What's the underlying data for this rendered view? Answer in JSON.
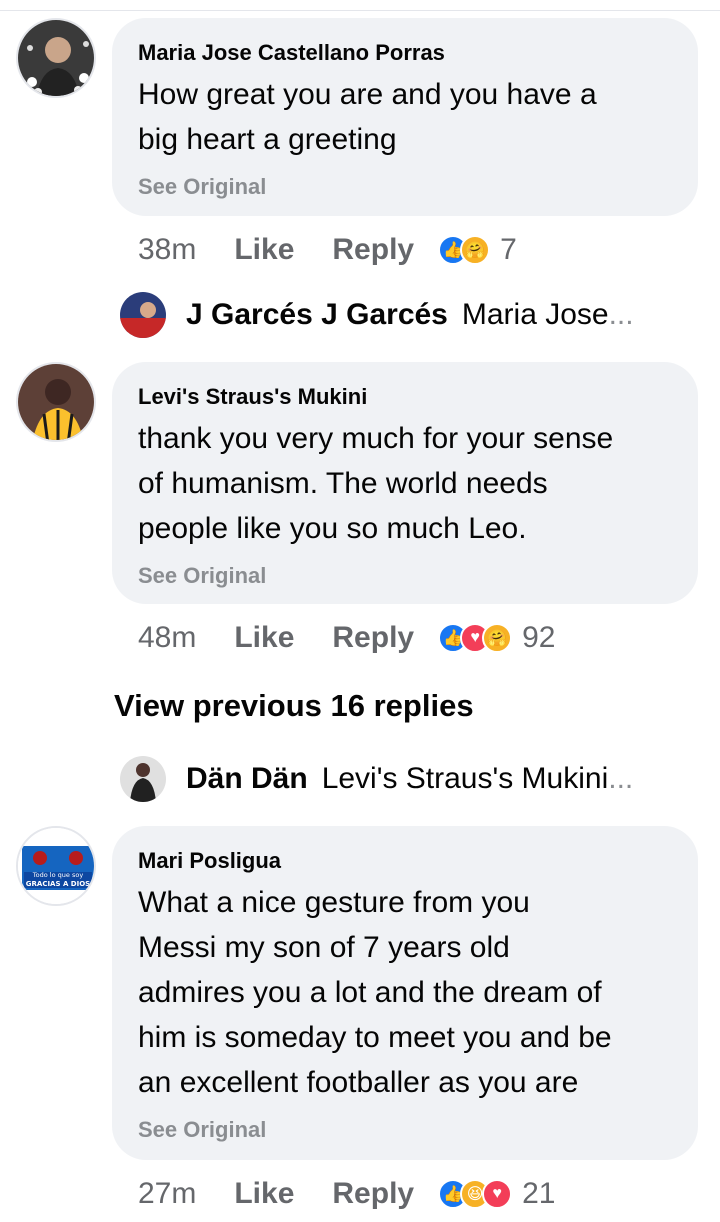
{
  "comments": [
    {
      "author": "Maria Jose Castellano Porras",
      "lines": [
        "How great you are and you have a",
        "big heart a greeting"
      ],
      "see_original": "See Original",
      "time": "38m",
      "like": "Like",
      "reply": "Reply",
      "reactions": [
        "like-icon",
        "care-icon"
      ],
      "reaction_count": "7"
    },
    {
      "author": "Levi's Straus's Mukini",
      "lines": [
        "thank you very much for your sense",
        "of humanism. The world needs",
        "people like you so much Leo."
      ],
      "see_original": "See Original",
      "time": "48m",
      "like": "Like",
      "reply": "Reply",
      "reactions": [
        "like-icon",
        "love-icon",
        "care-icon"
      ],
      "reaction_count": "92"
    },
    {
      "author": "Mari Posligua",
      "lines": [
        "What a nice gesture from you",
        "Messi my son of 7 years old",
        "admires you a lot and the dream of",
        "him is someday to meet you and be",
        "an excellent footballer as you are"
      ],
      "see_original": "See Original",
      "time": "27m",
      "like": "Like",
      "reply": "Reply",
      "reactions": [
        "like-icon",
        "haha-icon",
        "love-icon"
      ],
      "reaction_count": "21"
    }
  ],
  "replies": [
    {
      "name": "J Garcés J Garcés",
      "preview": "Maria Jose",
      "ellipsis": "..."
    },
    {
      "name": "Dän Dän",
      "preview": "Levi's Straus's Mukini",
      "ellipsis": "..."
    }
  ],
  "view_previous": "View previous 16 replies",
  "avatar_text": "Todo lo que soy es GRACIAS A DIOS",
  "colors": {
    "bubble": "#f0f2f5",
    "muted": "#65676b",
    "like_blue": "#1877f2",
    "love_red": "#f33e58",
    "care_yellow": "#f7b125"
  }
}
